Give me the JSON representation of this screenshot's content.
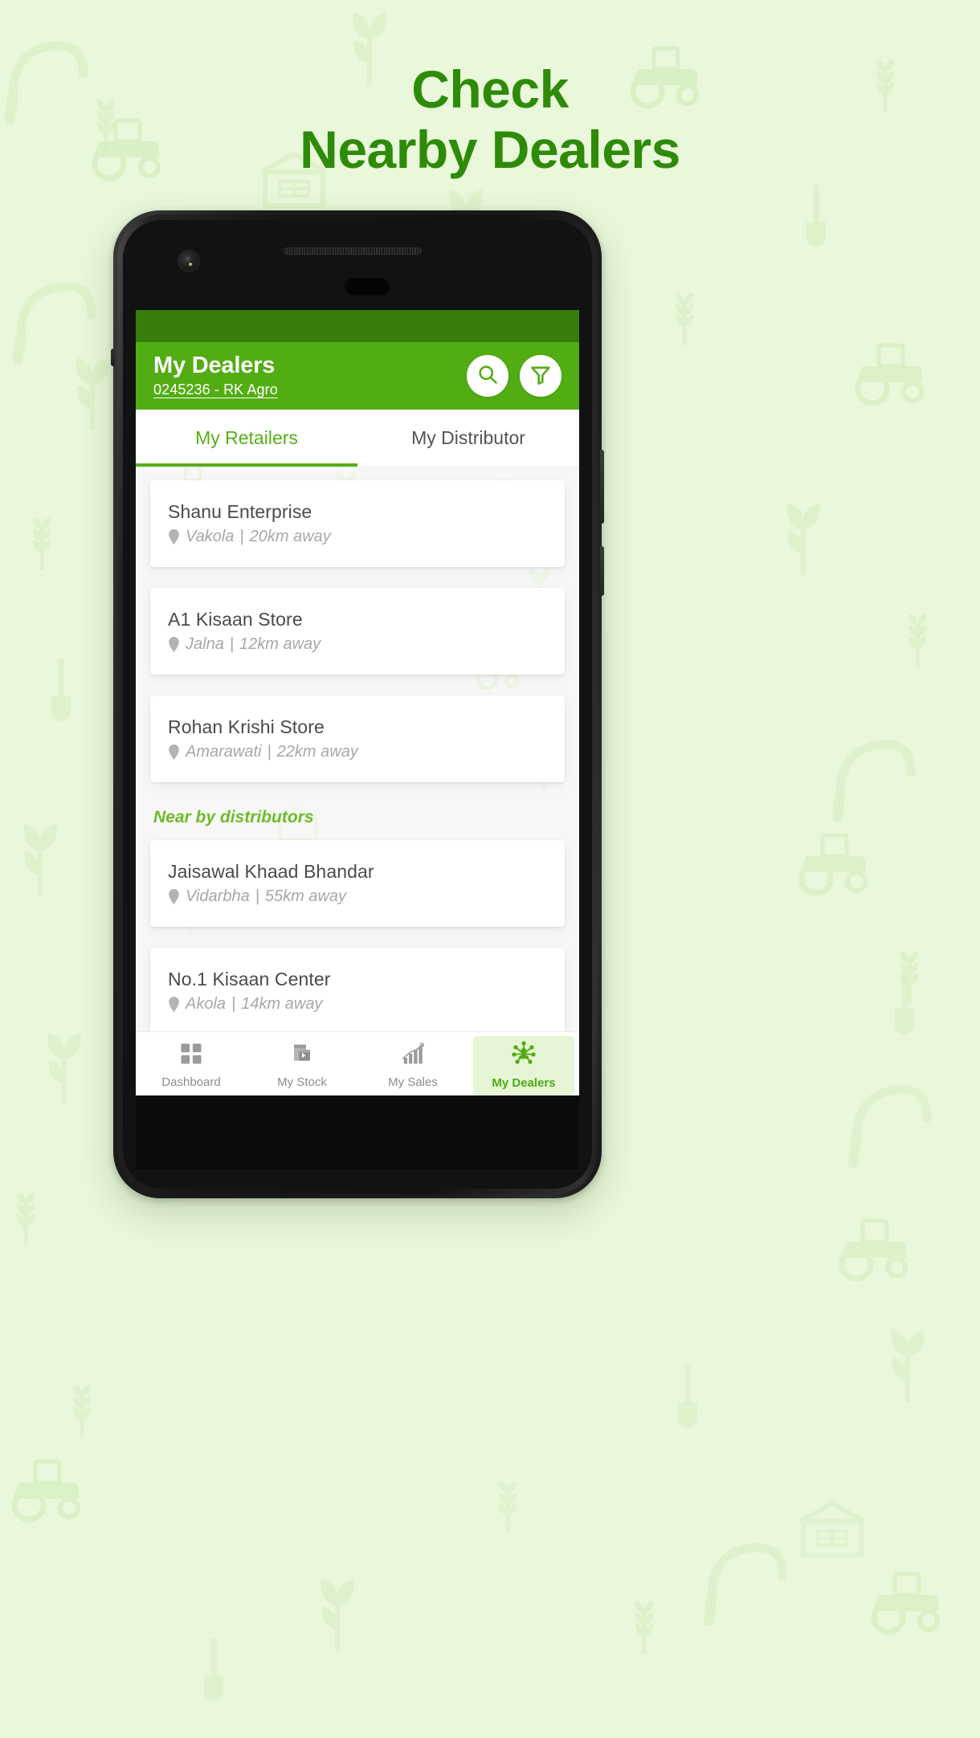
{
  "headline": {
    "line1": "Check",
    "line2": "Nearby Dealers",
    "color": "#2e8b09"
  },
  "colors": {
    "page_background": "#e9f7da",
    "status_bar": "#367d0c",
    "app_bar": "#52ad13",
    "accent_green": "#57ae18",
    "section_label_green": "#6ebb2a",
    "nav_active_bg": "#e5f5d6",
    "nav_active_text": "#4faa10",
    "card_background": "#ffffff",
    "list_background": "#f7f7f7"
  },
  "appbar": {
    "title": "My Dealers",
    "subtitle": "0245236 - RK Agro",
    "search_icon": "search-icon",
    "filter_icon": "filter-icon"
  },
  "tabs": [
    {
      "label": "My Retailers",
      "active": true
    },
    {
      "label": "My Distributor",
      "active": false
    }
  ],
  "retailers": [
    {
      "name": "Shanu Enterprise",
      "location": "Vakola",
      "separator": "|",
      "distance": "20km away"
    },
    {
      "name": "A1 Kisaan Store",
      "location": "Jalna",
      "separator": "|",
      "distance": "12km away"
    },
    {
      "name": "Rohan Krishi Store",
      "location": "Amarawati",
      "separator": "|",
      "distance": "22km away"
    }
  ],
  "distributors_section": {
    "label": "Near by distributors",
    "items": [
      {
        "name": "Jaisawal Khaad Bhandar",
        "location": "Vidarbha",
        "separator": "|",
        "distance": "55km away"
      },
      {
        "name": "No.1 Kisaan Center",
        "location": "Akola",
        "separator": "|",
        "distance": "14km away"
      }
    ]
  },
  "bottom_nav": [
    {
      "label": "Dashboard",
      "icon": "grid-icon",
      "active": false
    },
    {
      "label": "My Stock",
      "icon": "box-icon",
      "active": false
    },
    {
      "label": "My Sales",
      "icon": "bar-chart-icon",
      "active": false
    },
    {
      "label": "My Dealers",
      "icon": "network-nodes-icon",
      "active": true
    }
  ]
}
